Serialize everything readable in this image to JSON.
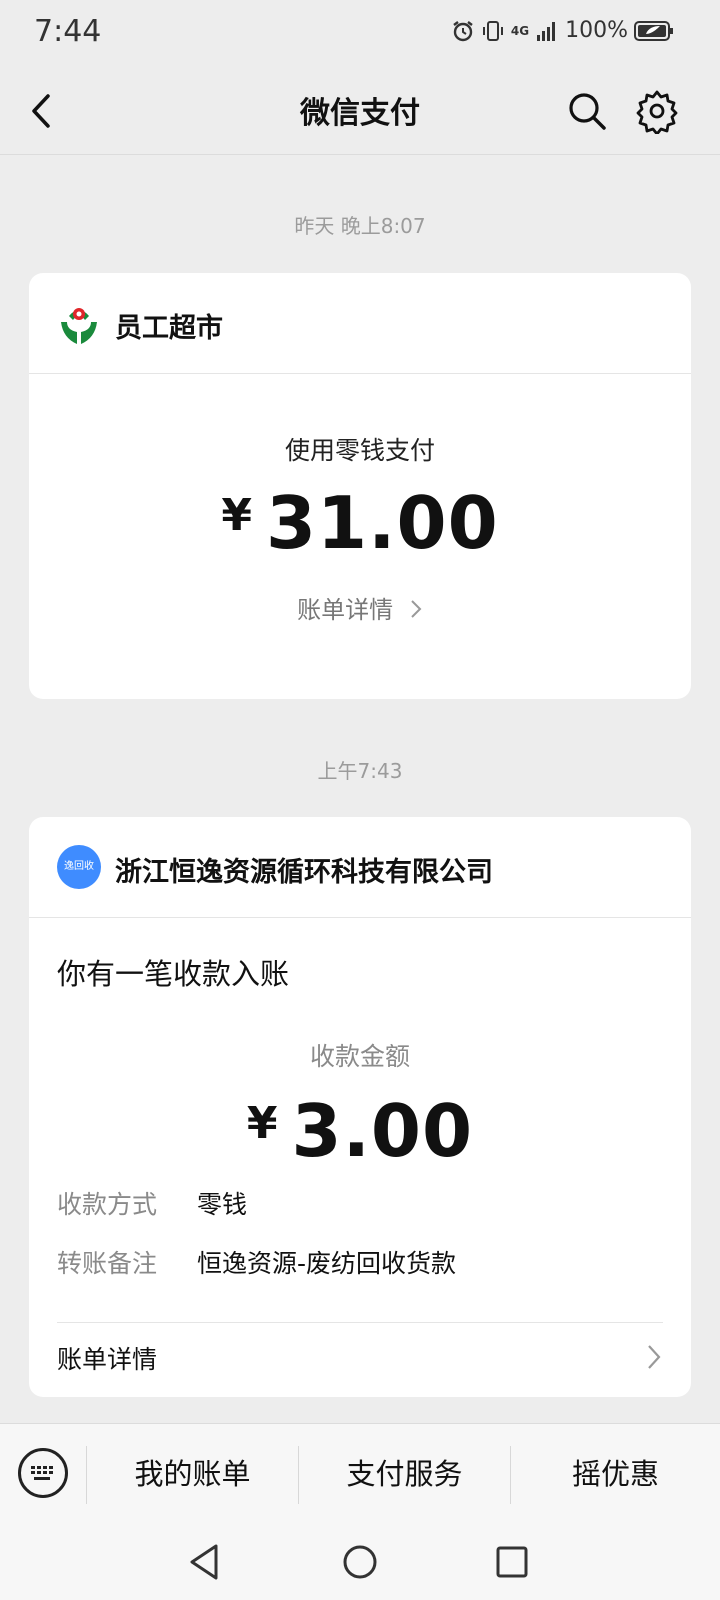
{
  "status": {
    "time": "7:44",
    "network": "4G",
    "battery": "100%"
  },
  "nav": {
    "title": "微信支付"
  },
  "messages": [
    {
      "timestamp": "昨天 晚上8:07",
      "merchant": "员工超市",
      "pay_method": "使用零钱支付",
      "currency": "¥",
      "amount": "31.00",
      "detail_link": "账单详情"
    },
    {
      "timestamp": "上午7:43",
      "merchant": "浙江恒逸资源循环科技有限公司",
      "logo_text": "逸回收",
      "title": "你有一笔收款入账",
      "amount_label": "收款金额",
      "currency": "¥",
      "amount": "3.00",
      "fields": [
        {
          "key": "收款方式",
          "value": "零钱"
        },
        {
          "key": "转账备注",
          "value": "恒逸资源-废纺回收货款"
        }
      ],
      "detail_link": "账单详情"
    }
  ],
  "bottom_tabs": [
    "我的账单",
    "支付服务",
    "摇优惠"
  ],
  "colors": {
    "background": "#ededed",
    "card": "#ffffff",
    "logo_green": "#1a8a3c",
    "logo_blue": "#3f8cff"
  }
}
